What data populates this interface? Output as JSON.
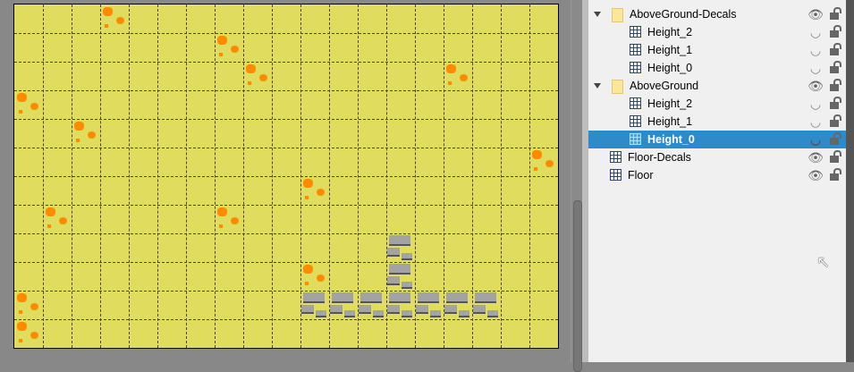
{
  "map": {
    "columns": 19,
    "rows": 12,
    "colors": {
      "background": "#e0dd5e",
      "decal": "#ff8c00",
      "brick": "#a3a3a3"
    },
    "decal_tiles": [
      [
        3,
        0
      ],
      [
        7,
        1
      ],
      [
        8,
        2
      ],
      [
        15,
        2
      ],
      [
        0,
        3
      ],
      [
        2,
        4
      ],
      [
        18,
        5
      ],
      [
        10,
        6
      ],
      [
        1,
        7
      ],
      [
        7,
        7
      ],
      [
        10,
        9
      ],
      [
        0,
        10
      ],
      [
        0,
        11
      ]
    ],
    "brick_tiles": [
      [
        13,
        8
      ],
      [
        13,
        9
      ],
      [
        10,
        10
      ],
      [
        11,
        10
      ],
      [
        12,
        10
      ],
      [
        13,
        10
      ],
      [
        14,
        10
      ],
      [
        15,
        10
      ],
      [
        16,
        10
      ]
    ]
  },
  "layers": [
    {
      "name": "AboveGround-Decals",
      "type": "group",
      "indent": 0,
      "visible": true,
      "selected": false
    },
    {
      "name": "Height_2",
      "type": "tile",
      "indent": 1,
      "visible": false,
      "selected": false
    },
    {
      "name": "Height_1",
      "type": "tile",
      "indent": 1,
      "visible": false,
      "selected": false
    },
    {
      "name": "Height_0",
      "type": "tile",
      "indent": 1,
      "visible": false,
      "selected": false
    },
    {
      "name": "AboveGround",
      "type": "group",
      "indent": 0,
      "visible": true,
      "selected": false
    },
    {
      "name": "Height_2",
      "type": "tile",
      "indent": 1,
      "visible": false,
      "selected": false
    },
    {
      "name": "Height_1",
      "type": "tile",
      "indent": 1,
      "visible": false,
      "selected": false
    },
    {
      "name": "Height_0",
      "type": "tile",
      "indent": 1,
      "visible": false,
      "selected": true
    },
    {
      "name": "Floor-Decals",
      "type": "tile",
      "indent": -1,
      "visible": true,
      "selected": false
    },
    {
      "name": "Floor",
      "type": "tile",
      "indent": -1,
      "visible": true,
      "selected": false
    }
  ],
  "selection_color": "#2e8bc9"
}
